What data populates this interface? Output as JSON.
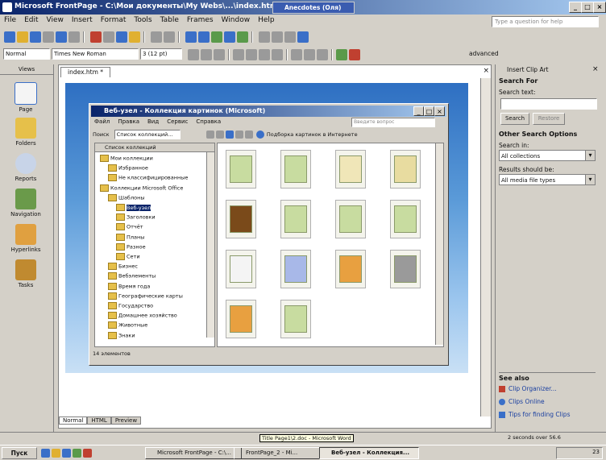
{
  "window": {
    "title": "Microsoft FrontPage - C:\\Мои документы\\My Webs\\...\\index.htm",
    "inline_tab": "Anecdotes (Оля)"
  },
  "menu": [
    "File",
    "Edit",
    "View",
    "Insert",
    "Format",
    "Tools",
    "Table",
    "Frames",
    "Window",
    "Help"
  ],
  "help_placeholder": "Type a question for help",
  "formatting": {
    "style": "Normal",
    "font": "Times New Roman",
    "size": "3 (12 pt)",
    "advanced": "advanced"
  },
  "views": {
    "header": "Views",
    "items": [
      {
        "label": "Page",
        "icon": "page-view-icon"
      },
      {
        "label": "Folders",
        "icon": "folders-view-icon"
      },
      {
        "label": "Reports",
        "icon": "reports-view-icon"
      },
      {
        "label": "Navigation",
        "icon": "navigation-view-icon"
      },
      {
        "label": "Hyperlinks",
        "icon": "hyperlinks-view-icon"
      },
      {
        "label": "Tasks",
        "icon": "tasks-view-icon"
      }
    ]
  },
  "editor": {
    "tab": "index.htm *",
    "bottom_tabs": [
      "Normal",
      "HTML",
      "Preview"
    ]
  },
  "dialog": {
    "title": "Веб-узел - Коллекция картинок (Microsoft)",
    "menu": [
      "Файл",
      "Правка",
      "Вид",
      "Сервис",
      "Справка"
    ],
    "search_placeholder": "Введите вопрос",
    "search_button": "Поиск",
    "collection_combo": "Список коллекций...",
    "online_link": "Подборка картинок в Интернете",
    "tree_header": "Список коллекций",
    "tree": [
      {
        "label": "Мои коллекции",
        "level": 0
      },
      {
        "label": "Избранное",
        "level": 1
      },
      {
        "label": "Не классифицированные",
        "level": 1
      },
      {
        "label": "Коллекции Microsoft Office",
        "level": 0
      },
      {
        "label": "Шаблоны",
        "level": 1
      },
      {
        "label": "Веб-узел",
        "level": 2,
        "selected": true
      },
      {
        "label": "Заголовки",
        "level": 2
      },
      {
        "label": "Отчёт",
        "level": 2
      },
      {
        "label": "Планы",
        "level": 2
      },
      {
        "label": "Разное",
        "level": 2
      },
      {
        "label": "Сети",
        "level": 2
      },
      {
        "label": "Бизнес",
        "level": 1
      },
      {
        "label": "Вебэлементы",
        "level": 1
      },
      {
        "label": "Время года",
        "level": 1
      },
      {
        "label": "Географические карты",
        "level": 1
      },
      {
        "label": "Государство",
        "level": 1
      },
      {
        "label": "Домашнее хозяйство",
        "level": 1
      },
      {
        "label": "Животные",
        "level": 1
      },
      {
        "label": "Знаки",
        "level": 1
      }
    ],
    "clips": [
      {
        "icon": "document-clip-icon",
        "color": "#c8dca0"
      },
      {
        "icon": "document-clip-icon",
        "color": "#c8dca0"
      },
      {
        "icon": "folder-clip-icon",
        "color": "#f0e6b8"
      },
      {
        "icon": "film-clip-icon",
        "color": "#e8dca0"
      },
      {
        "icon": "banner-clip-icon",
        "color": "#7a4a1a"
      },
      {
        "icon": "document-clip-icon",
        "color": "#c8dca0"
      },
      {
        "icon": "home-page-clip-icon",
        "color": "#c8dca0"
      },
      {
        "icon": "info-page-clip-icon",
        "color": "#c8dca0"
      },
      {
        "icon": "form-clip-icon",
        "color": "#f4f4f4"
      },
      {
        "icon": "office-building-clip-icon",
        "color": "#a8b8e8"
      },
      {
        "icon": "music-note-clip-icon",
        "color": "#e8a040"
      },
      {
        "icon": "camera-clip-icon",
        "color": "#9a9a9a"
      },
      {
        "icon": "speaker-clip-icon",
        "color": "#e8a040"
      },
      {
        "icon": "question-page-clip-icon",
        "color": "#c8dca0"
      }
    ],
    "status": "14 элементов"
  },
  "task_pane": {
    "title": "Insert Clip Art",
    "search_for": "Search For",
    "search_text_label": "Search text:",
    "search_button": "Search",
    "restore_button": "Restore",
    "other_options": "Other Search Options",
    "search_in_label": "Search in:",
    "search_in_value": "All collections",
    "results_label": "Results should be:",
    "results_value": "All media file types",
    "see_also": "See also",
    "links": [
      "Clip Organizer...",
      "Clips Online",
      "Tips for finding Clips"
    ]
  },
  "status_bar": {
    "tooltip": "Title Page1\\2.doc - Microsoft Word",
    "time": "2 seconds over 56.6"
  },
  "taskbar": {
    "start": "Пуск",
    "items": [
      "Microsoft FrontPage - C:\\...",
      "FrontPage_2 - Mi...",
      "Веб-узел - Коллекция..."
    ],
    "clock": "23"
  }
}
